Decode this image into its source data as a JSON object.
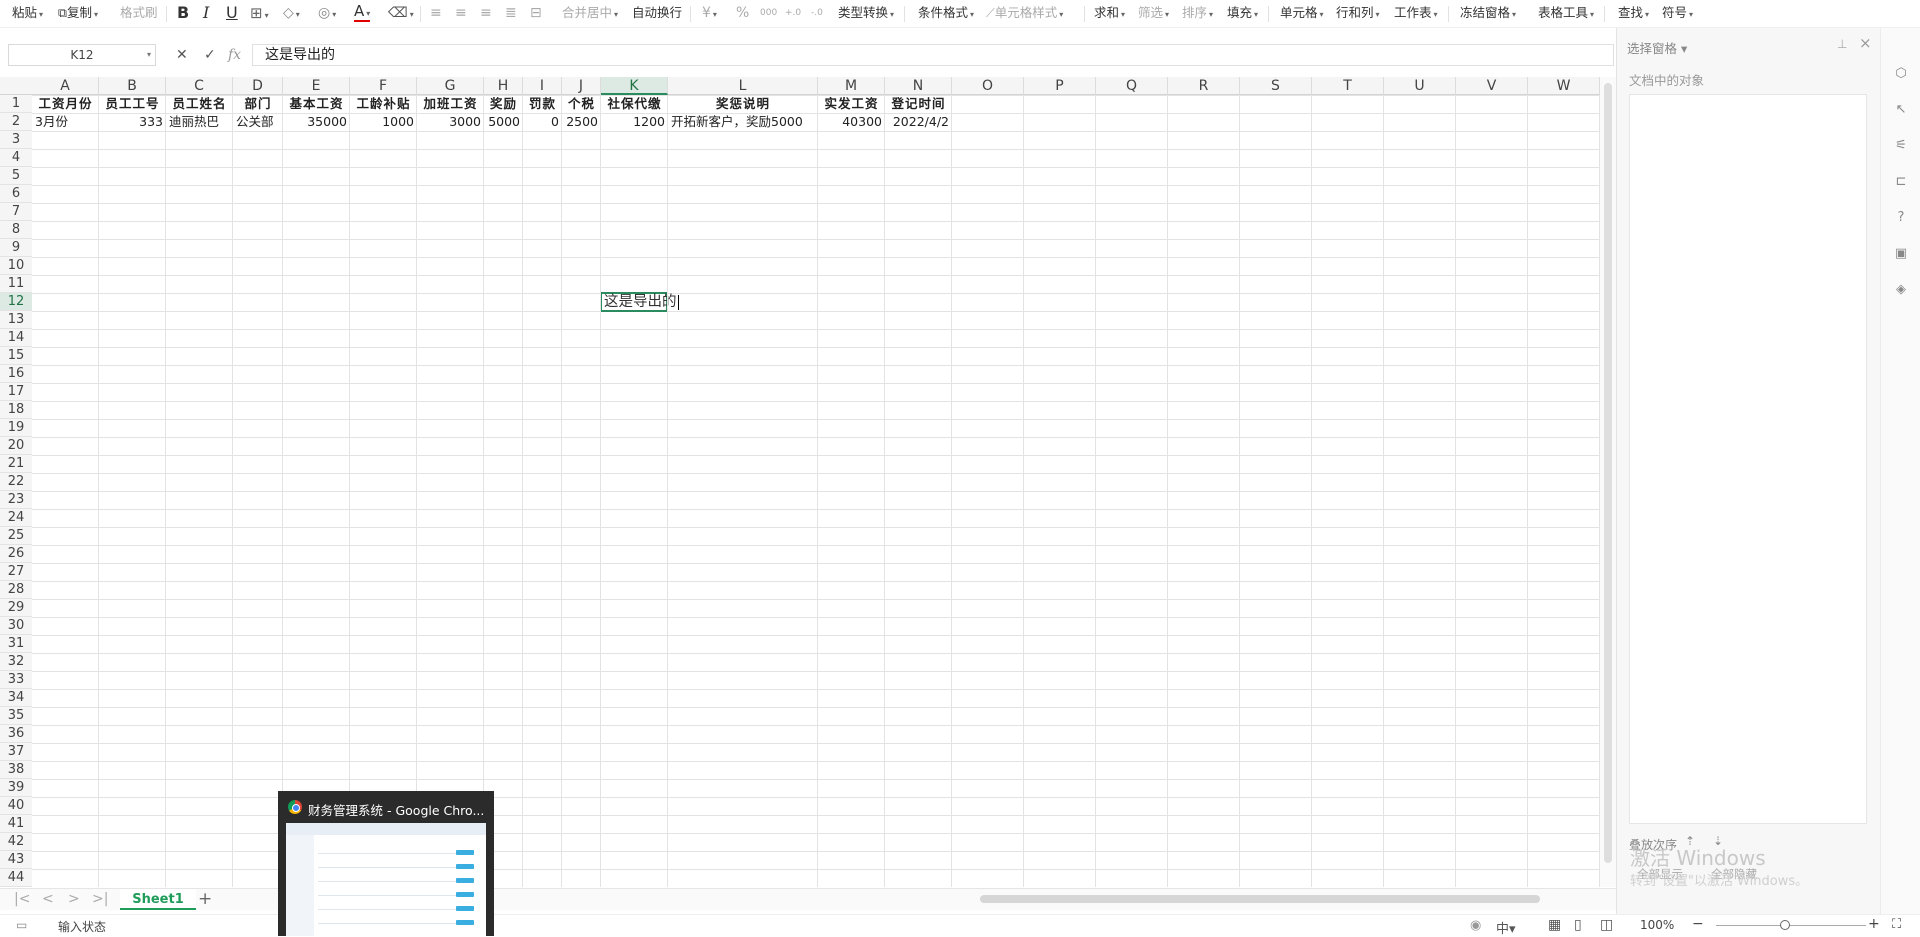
{
  "toolbar": {
    "paste": "粘贴",
    "copy": "复制",
    "format_painter": "格式刷",
    "bold": "B",
    "italic": "I",
    "underline": "U",
    "font_color_letter": "A",
    "merge_center": "合并居中",
    "auto_wrap": "自动换行",
    "currency": "¥",
    "percent": "%",
    "type_convert": "类型转换",
    "cond_format": "条件格式",
    "cell_style": "单元格样式",
    "sum": "求和",
    "filter": "筛选",
    "sort": "排序",
    "fill": "填充",
    "cell": "单元格",
    "row_col": "行和列",
    "worksheet": "工作表",
    "freeze": "冻结窗格",
    "table_tools": "表格工具",
    "find": "查找",
    "symbol": "符号"
  },
  "formula_bar": {
    "name_box": "K12",
    "cancel": "✕",
    "confirm": "✓",
    "fx": "fx",
    "content": "这是导出的"
  },
  "columns": [
    "A",
    "B",
    "C",
    "D",
    "E",
    "F",
    "G",
    "H",
    "I",
    "J",
    "K",
    "L",
    "M",
    "N",
    "O",
    "P",
    "Q",
    "R",
    "S",
    "T",
    "U",
    "V",
    "W"
  ],
  "selected_column": "K",
  "rows": [
    "1",
    "2",
    "3",
    "4",
    "5",
    "6",
    "7",
    "8",
    "9",
    "10",
    "11",
    "12",
    "13",
    "14",
    "15",
    "16",
    "17",
    "18",
    "19",
    "20",
    "21",
    "22",
    "23",
    "24",
    "25",
    "26",
    "27",
    "28",
    "29",
    "30",
    "31",
    "32",
    "33",
    "34",
    "35",
    "36",
    "37",
    "38",
    "39",
    "40",
    "41",
    "42",
    "43",
    "44"
  ],
  "selected_row": "12",
  "header_row": [
    "工资月份",
    "员工工号",
    "员工姓名",
    "部门",
    "基本工资",
    "工龄补贴",
    "加班工资",
    "奖励",
    "罚款",
    "个税",
    "社保代缴",
    "奖惩说明",
    "实发工资",
    "登记时间"
  ],
  "data_row": [
    "3月份",
    "333",
    "迪丽热巴",
    "公关部",
    "35000",
    "1000",
    "3000",
    "5000",
    "0",
    "2500",
    "1200",
    "开拓新客户，奖励5000",
    "40300",
    "2022/4/2"
  ],
  "active_cell_text": "这是导出的",
  "sheet_tabs": [
    "Sheet1"
  ],
  "status": {
    "mode": "输入状态",
    "zoom": "100%"
  },
  "right_panel": {
    "title": "选择窗格",
    "objects_label": "文档中的对象",
    "order_label": "叠放次序",
    "show_all": "全部显示",
    "hide_all": "全部隐藏"
  },
  "watermark": {
    "line1": "激活 Windows",
    "line2": "转到\"设置\"以激活 Windows。"
  },
  "taskbar_preview": {
    "title": "财务管理系统 - Google Chro..."
  },
  "colors": {
    "accent": "#1e9c5a",
    "selection": "#2a8c5e"
  }
}
